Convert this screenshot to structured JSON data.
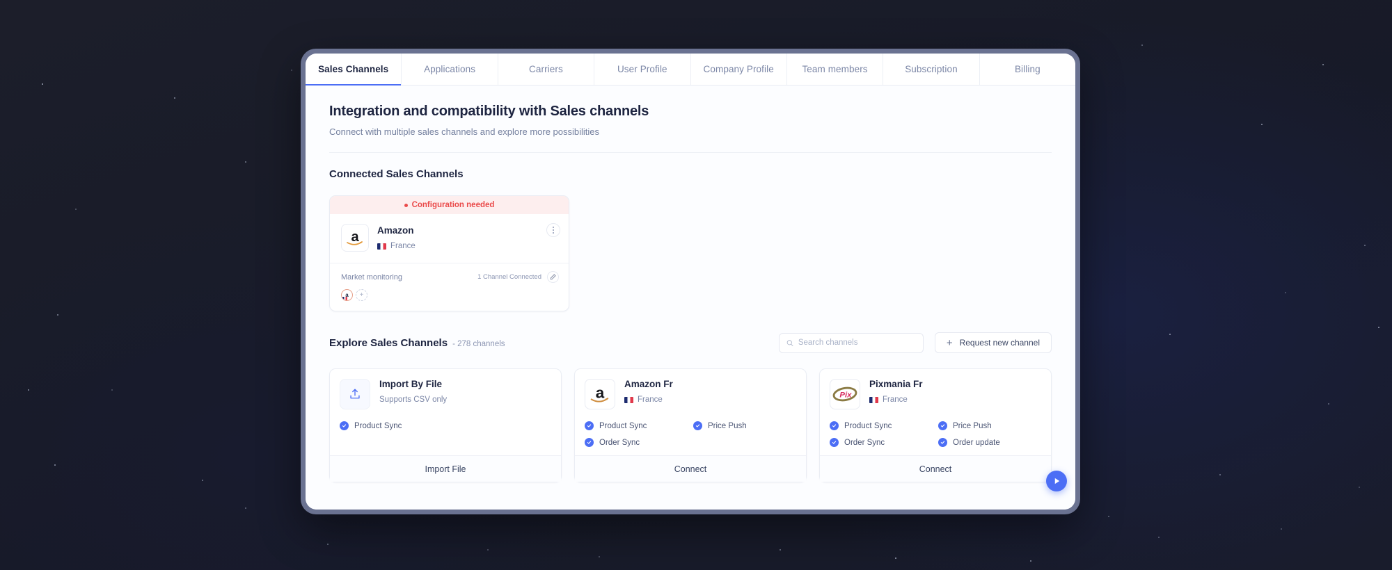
{
  "window": {
    "tabs": [
      {
        "label": "Sales Channels",
        "active": true
      },
      {
        "label": "Applications",
        "active": false
      },
      {
        "label": "Carriers",
        "active": false
      },
      {
        "label": "User Profile",
        "active": false
      },
      {
        "label": "Company Profile",
        "active": false
      },
      {
        "label": "Team members",
        "active": false
      },
      {
        "label": "Subscription",
        "active": false
      },
      {
        "label": "Billing",
        "active": false
      }
    ]
  },
  "header": {
    "title": "Integration and compatibility with Sales channels",
    "subtitle": "Connect with multiple sales channels and explore more possibilities"
  },
  "connected": {
    "section_title": "Connected Sales Channels",
    "cards": [
      {
        "status_label": "Configuration needed",
        "status_color": "#ea4a4a",
        "name": "Amazon",
        "country": "France",
        "logo": "amazon-logo",
        "footer_label": "Market monitoring",
        "footer_count": "1 Channel Connected",
        "avatar_initial": "a"
      }
    ]
  },
  "explore": {
    "title": "Explore Sales Channels",
    "count_label": "- 278 channels",
    "search": {
      "placeholder": "Search channels",
      "value": ""
    },
    "request_button": "Request new channel",
    "cards": [
      {
        "name": "Import By File",
        "sub": "Supports CSV only",
        "logo": "upload-icon",
        "country": "",
        "features": [
          "Product Sync"
        ],
        "button": "Import File"
      },
      {
        "name": "Amazon Fr",
        "sub": "",
        "logo": "amazon-logo",
        "country": "France",
        "features": [
          "Product Sync",
          "Price Push",
          "Order Sync"
        ],
        "button": "Connect"
      },
      {
        "name": "Pixmania Fr",
        "sub": "",
        "logo": "pixmania-logo",
        "country": "France",
        "features": [
          "Product Sync",
          "Price Push",
          "Order Sync",
          "Order update"
        ],
        "button": "Connect"
      }
    ]
  },
  "fab": {
    "icon": "play-icon"
  },
  "colors": {
    "accent": "#4c6ef5",
    "danger": "#ea4a4a",
    "page_bg": "#1b1d29",
    "frame": "#6a7291"
  }
}
